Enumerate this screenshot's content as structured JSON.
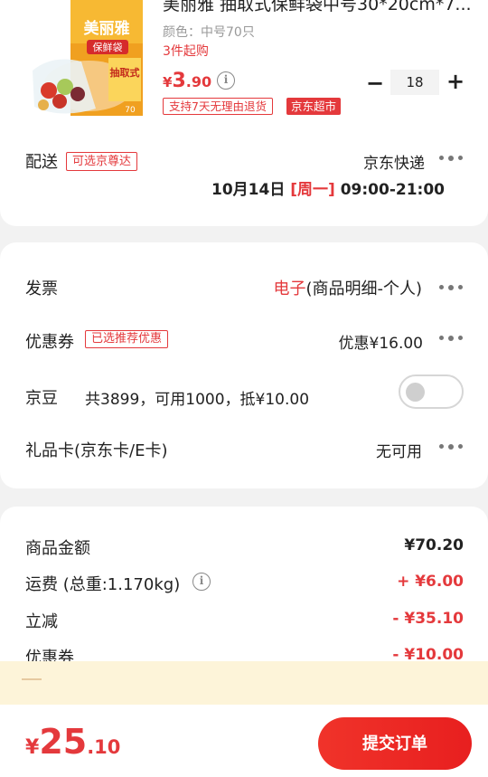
{
  "product": {
    "title": "美丽雅 抽取式保鲜袋中号30*20cm*7...",
    "spec": "颜色：中号70只",
    "min_order": "3件起购",
    "price_currency": "¥",
    "price_int": "3",
    "price_dec": ".90",
    "quantity": "18",
    "return_tag": "支持7天无理由退货",
    "store_tag": "京东超市",
    "brand_text": "美丽雅",
    "package_text_1": "保鲜袋",
    "package_text_2": "抽取式",
    "package_count": "70"
  },
  "delivery": {
    "label": "配送",
    "badge": "可选京尊达",
    "carrier": "京东快递",
    "date": "10月14日",
    "weekday": "[周一]",
    "time": "09:00-21:00"
  },
  "invoice": {
    "label": "发票",
    "type": "电子",
    "detail": "(商品明细-个人)"
  },
  "coupon": {
    "label": "优惠券",
    "badge": "已选推荐优惠",
    "value": "优惠¥16.00"
  },
  "jingdou": {
    "label": "京豆",
    "desc": "共3899，可用1000，抵¥10.00",
    "enabled": false
  },
  "giftcard": {
    "label": "礼品卡(京东卡/E卡)",
    "value": "无可用"
  },
  "summary": {
    "goods_label": "商品金额",
    "goods_value": "¥70.20",
    "shipping_label": "运费 (总重:1.170kg)",
    "shipping_value": "+ ¥6.00",
    "discount_label": "立减",
    "discount_value": "- ¥35.10",
    "coupon_label": "优惠券",
    "coupon_value": "- ¥10.00"
  },
  "footer": {
    "total_currency": "¥",
    "total_int": "25",
    "total_dec": ".10",
    "submit_label": "提交订单"
  },
  "icons": {
    "info": "info-icon",
    "more": "more-dots-icon",
    "minus": "−",
    "plus": "+",
    "info_glyph": "i"
  },
  "colors": {
    "accent": "#e4393c",
    "cream": "#fdf4d9"
  }
}
